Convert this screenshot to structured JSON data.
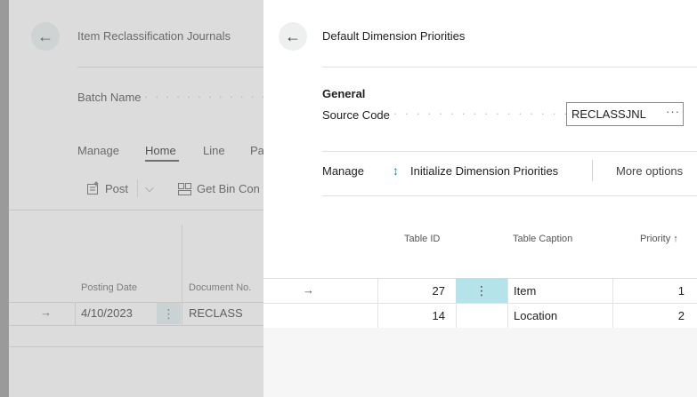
{
  "background_page": {
    "title": "Item Reclassification Journals",
    "batch_label": "Batch Name",
    "batch_dots": "· · · · · · · · · · · ·",
    "tabs": [
      "Manage",
      "Home",
      "Line",
      "Pa"
    ],
    "actions": {
      "post": "Post",
      "get_bin": "Get Bin Con"
    },
    "columns": [
      "Posting Date",
      "Document No."
    ],
    "rows": [
      {
        "posting_date": "4/10/2023",
        "document_no": "RECLASS"
      }
    ]
  },
  "dialog": {
    "title": "Default Dimension Priorities",
    "section_title": "General",
    "source_code_label": "Source Code",
    "source_code_dots": "· · · · · · · · · · · · · · · ·",
    "source_code_value": "RECLASSJNL",
    "assist_glyph": "···",
    "actions": {
      "manage": "Manage",
      "initialize": "Initialize Dimension Priorities",
      "more": "More options"
    },
    "columns": {
      "table_id": "Table ID",
      "table_caption": "Table Caption",
      "priority": "Priority ↑"
    },
    "rows": [
      {
        "table_id": "27",
        "table_caption": "Item",
        "priority": "1"
      },
      {
        "table_id": "14",
        "table_caption": "Location",
        "priority": "2"
      }
    ]
  },
  "icons": {
    "back": "←",
    "row_arrow": "→",
    "more_vertical": "⋮",
    "chevron_down": "⌵",
    "sort_updown": "↕"
  },
  "colors": {
    "selected_cell": "#b5e3ea",
    "overlay_gray": "#dcdcdc"
  }
}
